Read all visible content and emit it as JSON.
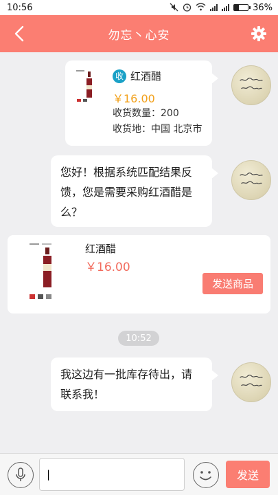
{
  "status_bar": {
    "time": "10:56",
    "battery_text": "36%",
    "battery_level": 0.36,
    "icons": [
      "mute-icon",
      "alarm-icon",
      "wifi-icon",
      "signal-icon",
      "signal-icon",
      "battery-icon"
    ]
  },
  "header": {
    "title": "勿忘丶心安",
    "back_icon": "chevron-left-icon",
    "settings_icon": "gear-icon"
  },
  "messages": {
    "product_info": {
      "badge": "收",
      "name": "红酒醋",
      "price": "￥16.00",
      "quantity": "收货数量：200",
      "location": "收货地：中国 北京市"
    },
    "text_1": "您好！根据系统匹配结果反馈，您是需要采购红酒醋是么？",
    "product_card": {
      "name": "红酒醋",
      "price": "￥16.00",
      "send_button": "发送商品"
    },
    "timestamp": "10:52",
    "text_2": "我这边有一批库存待出，请联系我！"
  },
  "input_bar": {
    "input_value": "|",
    "send_label": "发送"
  },
  "colors": {
    "accent": "#fb7e72",
    "price_orange": "#f2a019",
    "price_red": "#f26b5d",
    "badge_blue": "#1aa1c7"
  }
}
